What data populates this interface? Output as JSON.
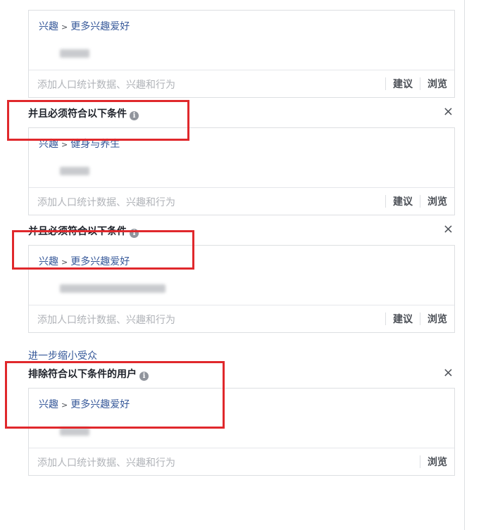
{
  "path_separator": ">",
  "condition_label": "并且必须符合以下条件",
  "exclude_label": "排除符合以下条件的用户",
  "narrow_link": "进一步缩小受众",
  "info_glyph": "i",
  "close_glyph": "×",
  "placeholder": "添加人口统计数据、兴趣和行为",
  "suggest_label": "建议",
  "browse_label": "浏览",
  "boxes": [
    {
      "category": "兴趣",
      "subcategory": "更多兴趣爱好"
    },
    {
      "category": "兴趣",
      "subcategory": "健身与养生"
    },
    {
      "category": "兴趣",
      "subcategory": "更多兴趣爱好"
    },
    {
      "category": "兴趣",
      "subcategory": "更多兴趣爱好"
    }
  ],
  "colors": {
    "link": "#365899",
    "highlight_border": "#e0282c",
    "border": "#dddfe2",
    "placeholder": "#b0b3b8"
  }
}
